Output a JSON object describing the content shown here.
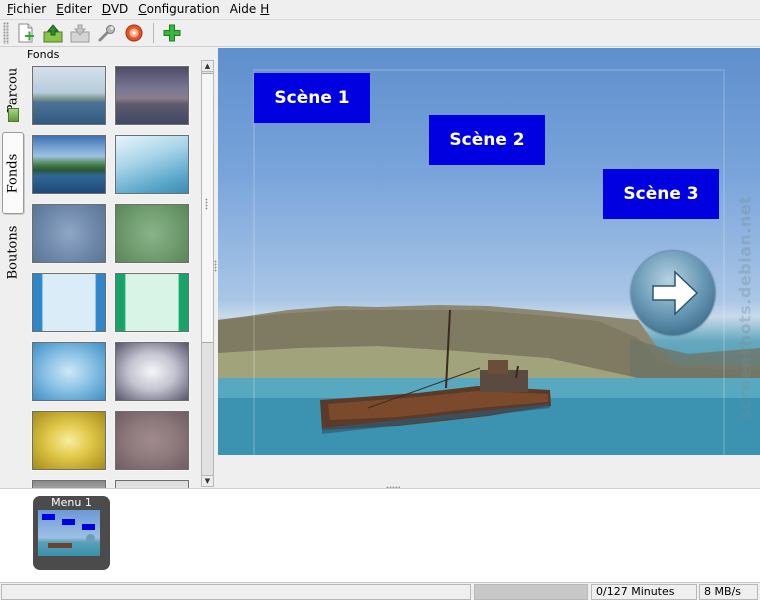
{
  "menubar": {
    "items": [
      "Fichier",
      "Editer",
      "DVD",
      "Configuration",
      "Aide"
    ],
    "shortcut_char": "H"
  },
  "toolbar": {
    "buttons": [
      "new-document-icon",
      "open-folder-icon",
      "save-icon",
      "wrench-icon",
      "burn-disc-icon",
      "add-icon"
    ]
  },
  "vtabs": [
    "Parcou",
    "Fonds",
    "Boutons"
  ],
  "thumbs": {
    "title": "Fonds",
    "count": 14
  },
  "preview": {
    "scenes": [
      "Scène 1",
      "Scène 2",
      "Scène 3"
    ],
    "next_icon": "arrow-right-icon",
    "watermark": "screenshots.debian.net"
  },
  "menus": {
    "items": [
      {
        "label": "Menu 1"
      }
    ]
  },
  "status": {
    "left": "",
    "duration": "0/127 Minutes",
    "size": "8 MB/s"
  },
  "colors": {
    "scene_button": "#0000e0",
    "window": "#efefef"
  }
}
